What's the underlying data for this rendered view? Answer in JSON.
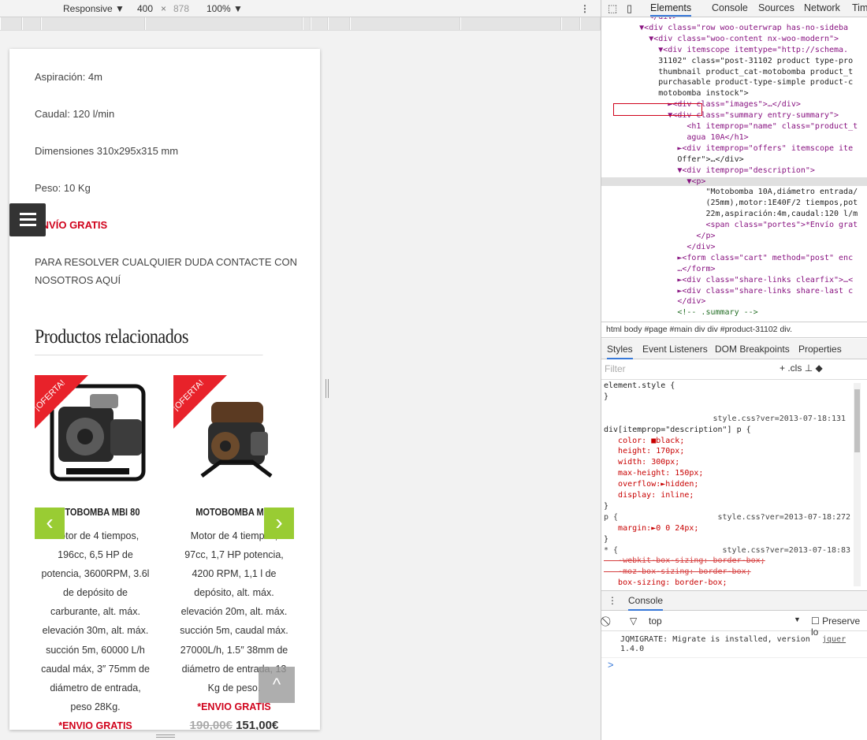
{
  "device_bar": {
    "mode": "Responsive",
    "width": "400",
    "times": "×",
    "height": "878",
    "zoom": "100%",
    "more": "⋮"
  },
  "page": {
    "specs": [
      "Aspiración: 4m",
      "Caudal: 120 l/min",
      "Dimensiones 310x295x315 mm",
      "Peso: 10 Kg"
    ],
    "shipping": "ENVÍO GRATIS",
    "contact": [
      "PARA RESOLVER CUALQUIER DUDA CONTACTE CON",
      "NOSOTROS AQUÍ"
    ],
    "related_title": "Productos relacionados",
    "ribbon": "¡OFERTA!",
    "products": [
      {
        "name": "MOTOBOMBA MBI 80",
        "desc_lines": [
          "Motor de 4 tiempos,",
          "196cc, 6,5 HP de",
          "potencia, 3600RPM, 3.6l",
          "de depósito de",
          "carburante, alt. máx.",
          "elevación 30m, alt. máx.",
          "succión 5m, 60000 L/h",
          "caudal máx, 3″ 75mm de",
          "diámetro de entrada,",
          "peso 28Kg."
        ],
        "shipping": "*ENVIO GRATIS"
      },
      {
        "name": "MOTOBOMBA MBI",
        "desc_lines": [
          "Motor de 4 tiempos,",
          "97cc, 1,7 HP potencia,",
          "4200 RPM, 1,1 l de",
          "depósito, alt. máx.",
          "elevación 20m, alt. máx.",
          "succión 5m, caudal máx.",
          "27000L/h, 1.5″ 38mm de",
          "diámetro de entrada, 13",
          "Kg de peso."
        ],
        "shipping": "*ENVIO GRATIS",
        "old_price": "190,00€",
        "price": "151,00€"
      }
    ],
    "prev_arrow": "‹",
    "next_arrow": "›",
    "to_top": "^"
  },
  "devtools": {
    "tabs": [
      "Elements",
      "Console",
      "Sources",
      "Network",
      "Tim"
    ],
    "breadcrumbs": "html  body  #page  #main  div  div  #product-31102  div.",
    "style_tabs": [
      "Styles",
      "Event Listeners",
      "DOM Breakpoints",
      "Properties"
    ],
    "filter_placeholder": "Filter",
    "filter_tools": "+  .cls",
    "console_tab": "Console",
    "console_context": "top",
    "preserve_log": "Preserve lo",
    "console_message": "JQMIGRATE: Migrate is installed, version\n1.4.0",
    "console_source": "jquer",
    "prompt": ">",
    "dom_lines": [
      "          </div>",
      "        ▼<div class=\"row woo-outerwrap has-no-sideba",
      "          ▼<div class=\"woo-content nx-woo-modern\">",
      "            ▼<div itemscope itemtype=\"http://schema.",
      "            31102\" class=\"post-31102 product type-pro",
      "            thumbnail product_cat-motobomba product_t",
      "            purchasable product-type-simple product-c",
      "            motobomba instock\">",
      "              ►<div class=\"images\">…</div>",
      "              ▼<div class=\"summary entry-summary\">",
      "                  <h1 itemprop=\"name\" class=\"product_t",
      "                  agua 10A</h1>",
      "                ►<div itemprop=\"offers\" itemscope ite",
      "                Offer\">…</div>",
      "                ▼<div itemprop=\"description\">",
      "                  ▼<p>",
      "                      \"Motobomba 10A,diámetro entrada/",
      "                      (25mm),motor:1E40F/2 tiempos,pot",
      "                      22m,aspiración:4m,caudal:120 l/m",
      "                      <span class=\"portes\">*Envío grat",
      "                    </p>",
      "                  </div>",
      "                ►<form class=\"cart\" method=\"post\" enc",
      "                …</form>",
      "                ►<div class=\"share-links clearfix\">…<",
      "                ►<div class=\"share-links share-last c",
      "                </div>",
      "                <!-- .summary -->"
    ],
    "css_lines": [
      "element.style {",
      "}",
      "",
      "                       style.css?ver=2013-07-18:131",
      "div[itemprop=\"description\"] p {",
      "   color: ■black;",
      "   height: 170px;",
      "   width: 300px;",
      "   max-height: 150px;",
      "   overflow:►hidden;",
      "   display: inline;",
      "}",
      "p {                     style.css?ver=2013-07-18:272",
      "   margin:►0 0 24px;",
      "}",
      "* {                      style.css?ver=2013-07-18:83",
      "   -webkit-box-sizing: border-box;",
      "   -moz-box-sizing: border-box;",
      "   box-sizing: border-box;"
    ]
  }
}
